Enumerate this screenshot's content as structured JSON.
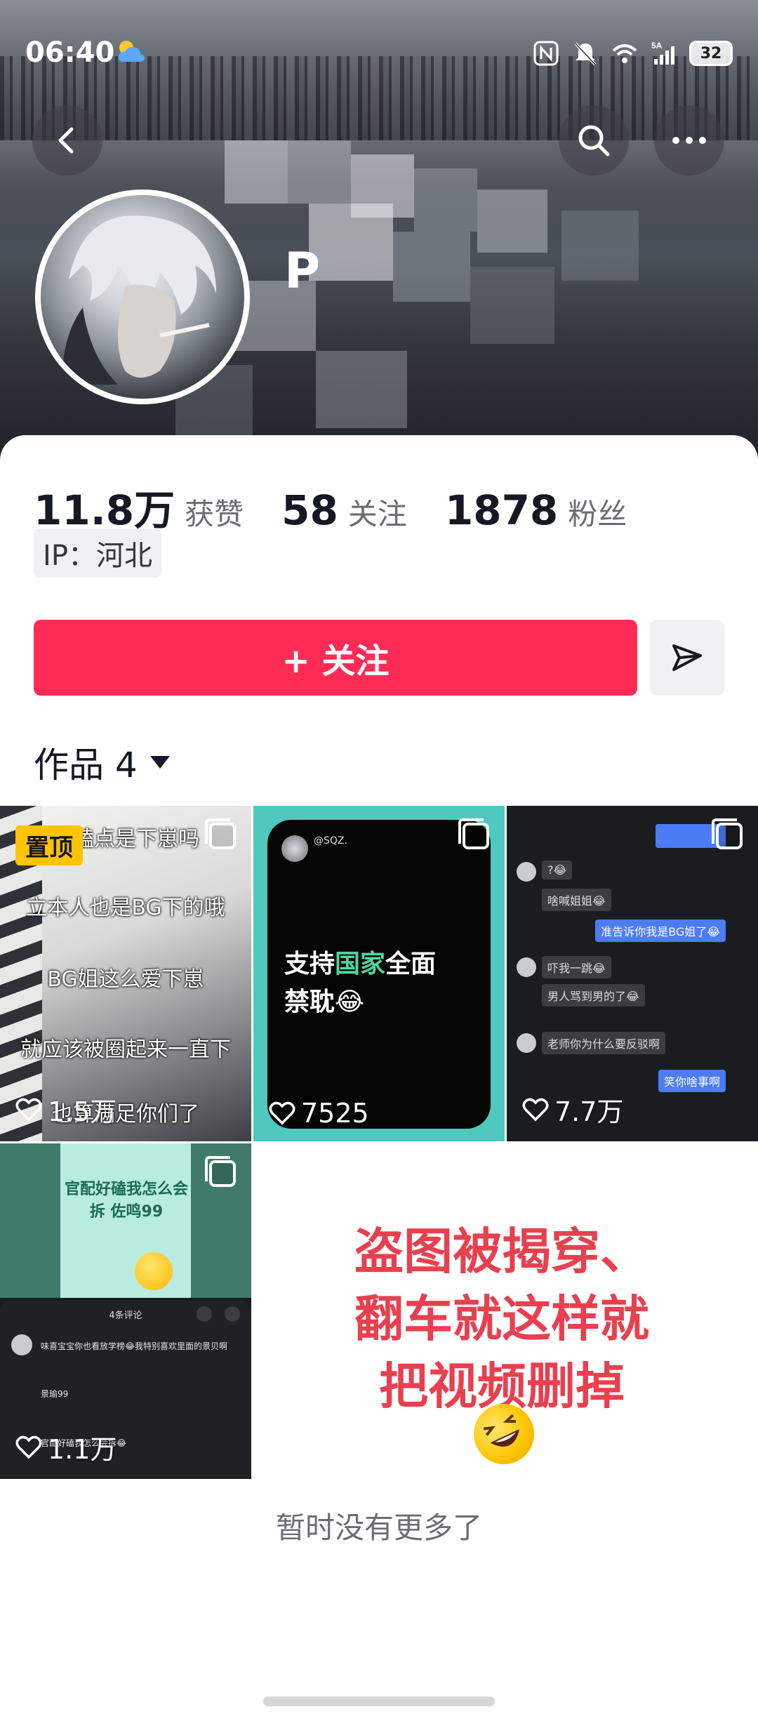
{
  "status_bar": {
    "time": "06:40",
    "battery": "32",
    "signal_label": "5A"
  },
  "header": {
    "back_icon": "chevron-left-icon",
    "search_icon": "search-icon",
    "more_icon": "more-dots-icon"
  },
  "profile": {
    "name": "P",
    "name_blurred": true
  },
  "stats": [
    {
      "value": "11.8万",
      "label": "获赞"
    },
    {
      "value": "58",
      "label": "关注"
    },
    {
      "value": "1878",
      "label": "粉丝"
    }
  ],
  "ip_location": "IP：河北",
  "actions": {
    "follow_label": "+ 关注",
    "share_icon": "send-icon"
  },
  "works_tab": {
    "label": "作品 4"
  },
  "works": [
    {
      "likes": "1.5万",
      "pinned_label": "置顶",
      "overlay_lines": [
        "的磕点是下崽吗",
        "立本人也是BG下的哦",
        "BG姐这么爱下崽",
        "就应该被圈起来一直下",
        "也算满足你们了"
      ]
    },
    {
      "likes": "7525",
      "handle": "@SQZ.",
      "headline_a": "支持",
      "headline_hl": "国家",
      "headline_b": "全面",
      "headline_2": "禁耽😂"
    },
    {
      "likes": "7.7万",
      "chat": [
        "?😂",
        "啥喊姐姐😂",
        "准告诉你我是BG姐了😂",
        "吓我一跳😂",
        "男人骂到男的了😂",
        "老师你为什么要反驳啊",
        "笑你啥事啊"
      ]
    },
    {
      "likes": "1.1万",
      "top_text": "官配好磕我怎么会拆 佐鸣99",
      "comments_title": "4条评论",
      "comments": [
        "味喜宝宝你也看放学榜😂我特别喜欢里面的景贝啊",
        "景瑜99",
        "官配好磕我怎么会拆😂"
      ]
    }
  ],
  "annotation": {
    "lines": [
      "盗图被揭穿、",
      "翻车就这样就",
      "把视频删掉"
    ],
    "emoji": "🤣"
  },
  "footer_text": "暂时没有更多了",
  "colors": {
    "accent": "#fe2c55",
    "annotation": "#e8404f",
    "pin": "#ffc300",
    "teal": "#4fc9bd"
  }
}
